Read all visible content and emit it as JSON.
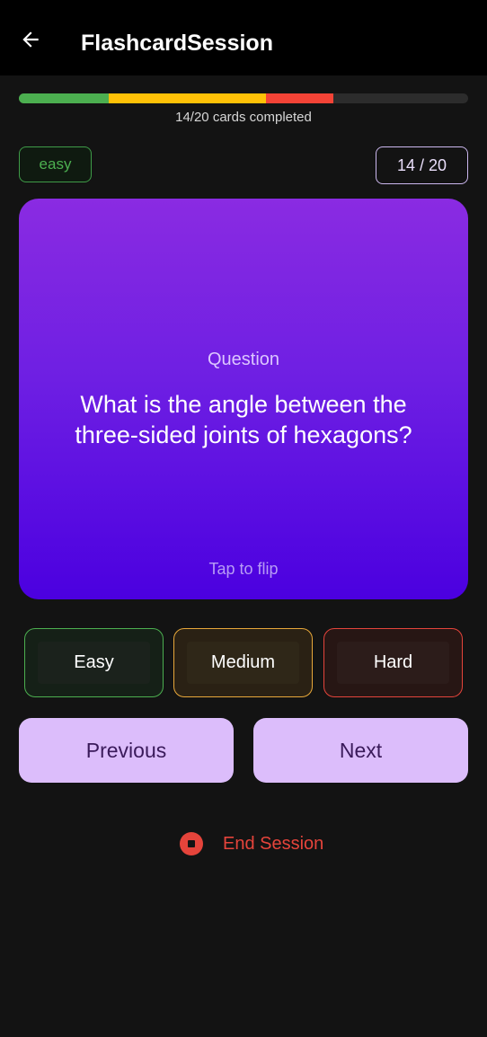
{
  "app_bar": {
    "title": "FlashcardSession",
    "back_icon": "arrow-left-icon"
  },
  "progress": {
    "label": "14/20 cards completed",
    "completed": 14,
    "total": 20,
    "segments": [
      {
        "name": "easy",
        "cards": 4,
        "color": "#4caf50"
      },
      {
        "name": "medium",
        "cards": 7,
        "color": "#ffc107"
      },
      {
        "name": "hard",
        "cards": 3,
        "color": "#f44336"
      }
    ],
    "track_color": "#2c2c2c"
  },
  "card_meta": {
    "difficulty": "easy",
    "counter": "14 / 20"
  },
  "card": {
    "label": "Question",
    "question": "What is the angle between the three-sided joints of hexagons?",
    "hint": "Tap to flip"
  },
  "rating": {
    "easy": "Easy",
    "medium": "Medium",
    "hard": "Hard"
  },
  "navigation": {
    "previous": "Previous",
    "next": "Next"
  },
  "end_session": {
    "label": "End Session",
    "icon": "stop-circle-icon",
    "color": "#e5443b"
  }
}
